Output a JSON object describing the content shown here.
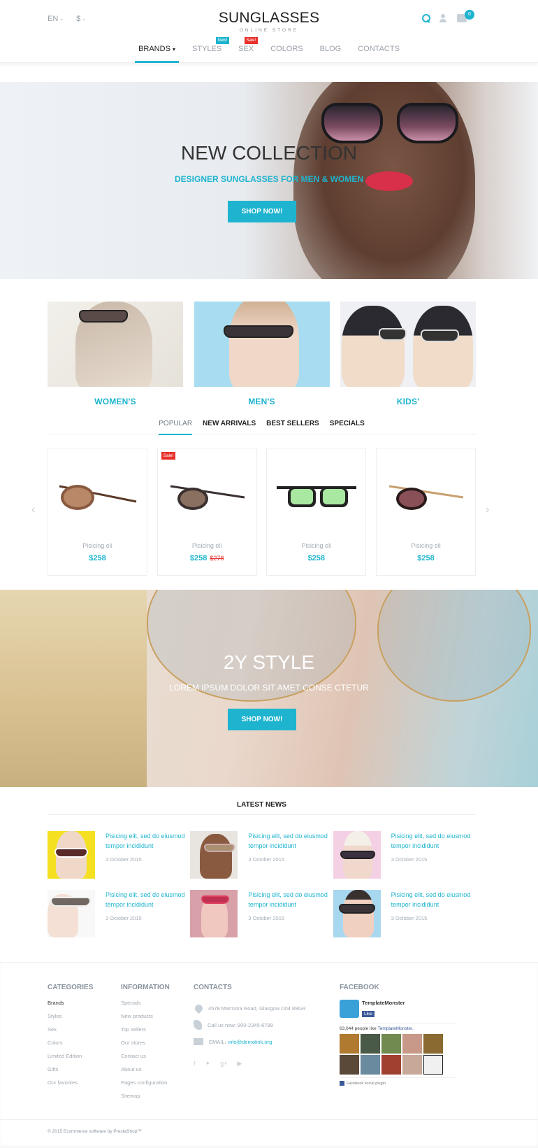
{
  "header": {
    "language": "EN",
    "currency": "$",
    "logo_title": "SUNGLASSES",
    "logo_subtitle": "ONLINE STORE",
    "cart_count": "0",
    "icons": [
      "search-icon",
      "user-icon",
      "cart-icon"
    ]
  },
  "nav": {
    "items": [
      {
        "label": "BRANDS",
        "active": true,
        "dropdown": true
      },
      {
        "label": "STYLES",
        "tag": "New!"
      },
      {
        "label": "SEX",
        "tag": "Sale!"
      },
      {
        "label": "COLORS"
      },
      {
        "label": "BLOG"
      },
      {
        "label": "CONTACTS"
      }
    ]
  },
  "hero": {
    "title": "NEW COLLECTION",
    "subtitle": "DESIGNER SUNGLASSES FOR MEN & WOMEN",
    "button": "SHOP NOW!"
  },
  "categories": [
    {
      "label": "WOMEN'S"
    },
    {
      "label": "MEN'S"
    },
    {
      "label": "KIDS'"
    }
  ],
  "product_tabs": [
    "POPULAR",
    "NEW ARRIVALS",
    "BEST SELLERS",
    "SPECIALS"
  ],
  "products": [
    {
      "name": "Pisicing eli",
      "price": "$258",
      "old_price": null,
      "sale": false
    },
    {
      "name": "Pisicing eli",
      "price": "$258",
      "old_price": "$278",
      "sale": true,
      "sale_label": "Sale!"
    },
    {
      "name": "Pisicing eli",
      "price": "$258",
      "old_price": null,
      "sale": false
    },
    {
      "name": "Pisicing eli",
      "price": "$258",
      "old_price": null,
      "sale": false
    }
  ],
  "banner2": {
    "title": "2Y STYLE",
    "subtitle": "LOREM IPSUM DOLOR SIT AMET CONSE CTETUR",
    "button": "SHOP NOW!"
  },
  "news": {
    "heading": "LATEST NEWS",
    "items": [
      {
        "title": "Pisicing elit, sed do eiusmod tempor incididunt",
        "date": "3 October 2015"
      },
      {
        "title": "Pisicing elit, sed do eiusmod tempor incididunt",
        "date": "3 October 2015"
      },
      {
        "title": "Pisicing elit, sed do eiusmod tempor incididunt",
        "date": "3 October 2015"
      },
      {
        "title": "Pisicing elit, sed do eiusmod tempor incididunt",
        "date": "3 October 2015"
      },
      {
        "title": "Pisicing elit, sed do eiusmod tempor incididunt",
        "date": "3 October 2015"
      },
      {
        "title": "Pisicing elit, sed do eiusmod tempor incididunt",
        "date": "3 October 2015"
      }
    ]
  },
  "footer": {
    "categories": {
      "heading": "CATEGORIES",
      "links": [
        "Brands",
        "Styles",
        "Sex",
        "Colors",
        "Limited Edition",
        "Gifts",
        "Our favorites"
      ]
    },
    "information": {
      "heading": "INFORMATION",
      "links": [
        "Specials",
        "New products",
        "Top sellers",
        "Our stores",
        "Contact us",
        "About us",
        "Pages configuration",
        "Sitemap"
      ]
    },
    "contacts": {
      "heading": "CONTACTS",
      "address": "4578 Marmora Road, Glasgow D04 89GR",
      "phone": "Call us now: 800-2345-6789",
      "email_label": "EMAIL:",
      "email": "info@demolink.org",
      "social": [
        "facebook-icon",
        "twitter-icon",
        "google-plus-icon",
        "youtube-icon"
      ]
    },
    "facebook": {
      "heading": "FACEBOOK",
      "page_name": "TemplateMonster",
      "like_label": "Like",
      "count_text": "63,044 people like",
      "count_link": "TemplateMonster.",
      "plugin_text": "Facebook social plugin"
    },
    "copyright": "© 2015 Ecommerce software by PrestaShop™"
  },
  "colors": {
    "accent": "#1eb4cf",
    "sale": "#e8312b",
    "text_dark": "#222222",
    "text_muted": "#a0a8b0"
  }
}
